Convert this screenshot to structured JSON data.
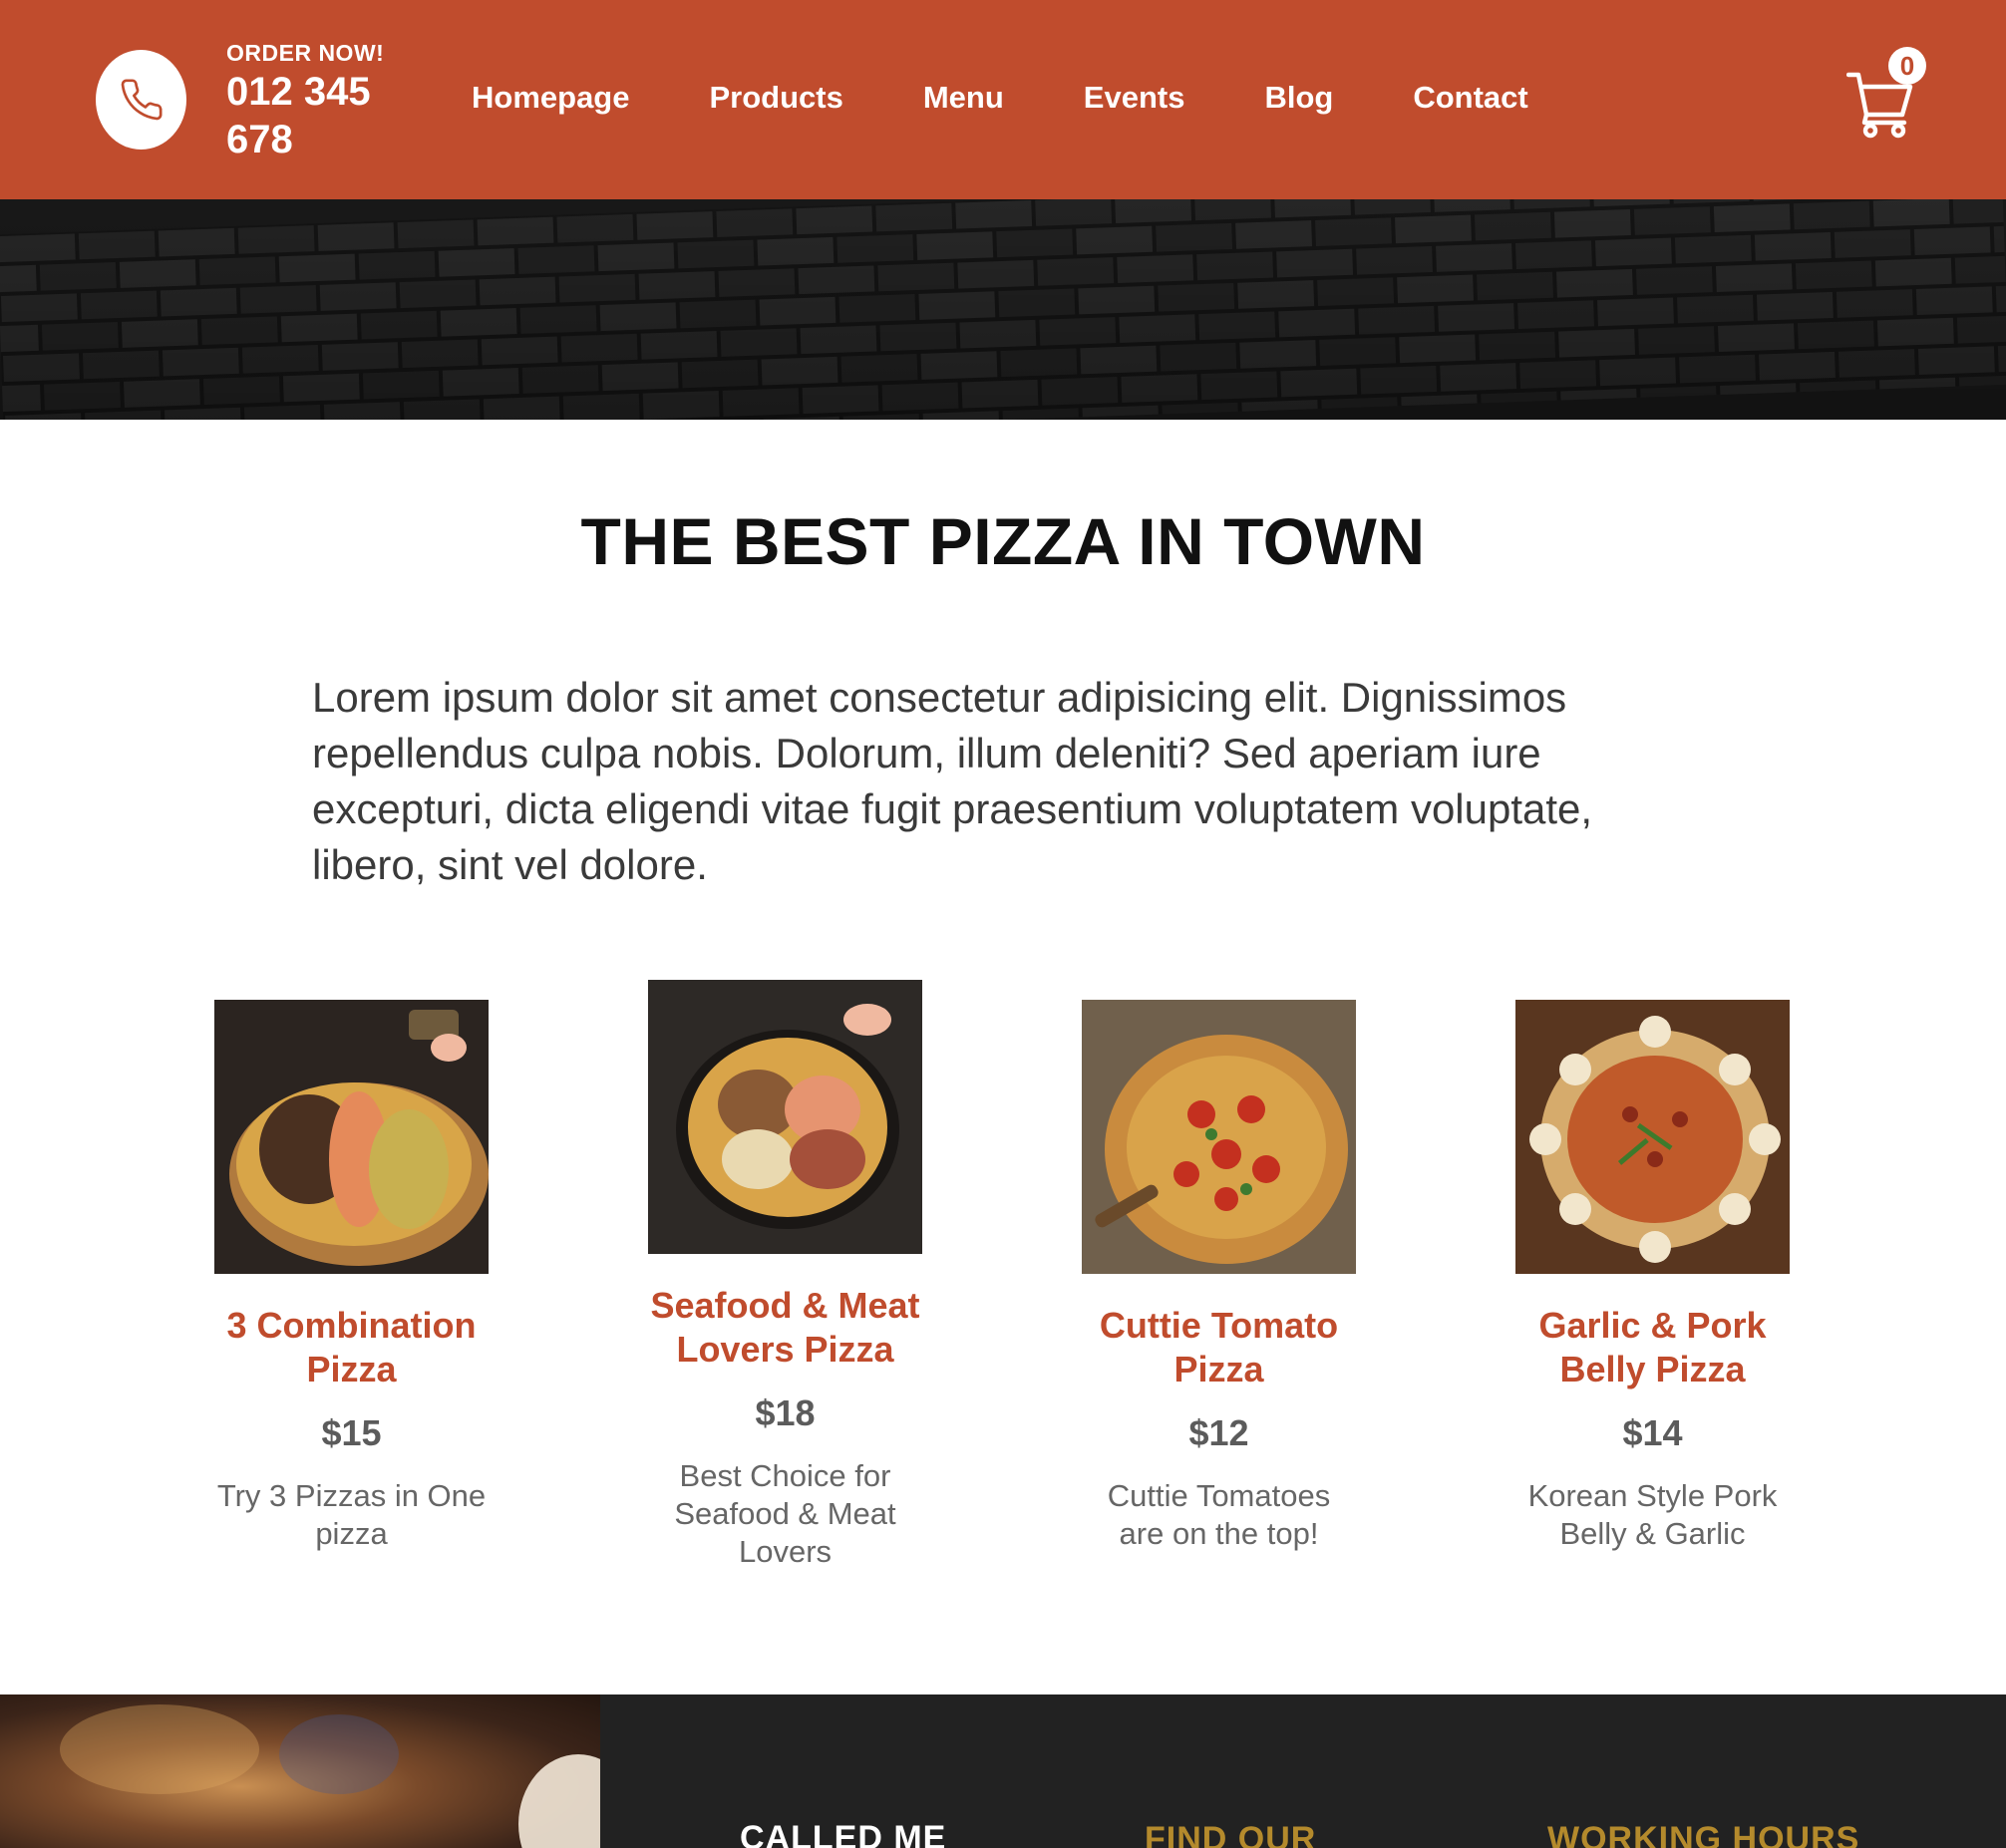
{
  "header": {
    "order_label": "ORDER NOW!",
    "order_number": "012 345 678",
    "nav": [
      "Homepage",
      "Products",
      "Menu",
      "Events",
      "Blog",
      "Contact"
    ],
    "cart_count": "0"
  },
  "main": {
    "title": "THE BEST PIZZA IN TOWN",
    "intro": "Lorem ipsum dolor sit amet consectetur adipisicing elit. Dignissimos repellendus culpa nobis. Dolorum, illum deleniti? Sed aperiam iure excepturi, dicta eligendi vitae fugit praesentium voluptatem voluptate, libero, sint vel dolore."
  },
  "products": [
    {
      "name": "3 Combination Pizza",
      "price": "$15",
      "desc": "Try 3 Pizzas in One pizza"
    },
    {
      "name": "Seafood & Meat Lovers Pizza",
      "price": "$18",
      "desc": "Best Choice for Seafood & Meat Lovers"
    },
    {
      "name": "Cuttie Tomato Pizza",
      "price": "$12",
      "desc": "Cuttie Tomatoes are on the top!"
    },
    {
      "name": "Garlic & Pork Belly Pizza",
      "price": "$14",
      "desc": "Korean Style Pork Belly & Garlic"
    }
  ],
  "footer": {
    "col1_heading": "CALLED ME",
    "col2_heading": "FIND OUR",
    "col3_heading": "WORKING HOURS"
  },
  "colors": {
    "brand": "#c04c2d",
    "footer_dark": "#222222",
    "footer_gold": "#b48a2c"
  },
  "icons": {
    "phone": "phone-icon",
    "cart": "cart-icon"
  }
}
